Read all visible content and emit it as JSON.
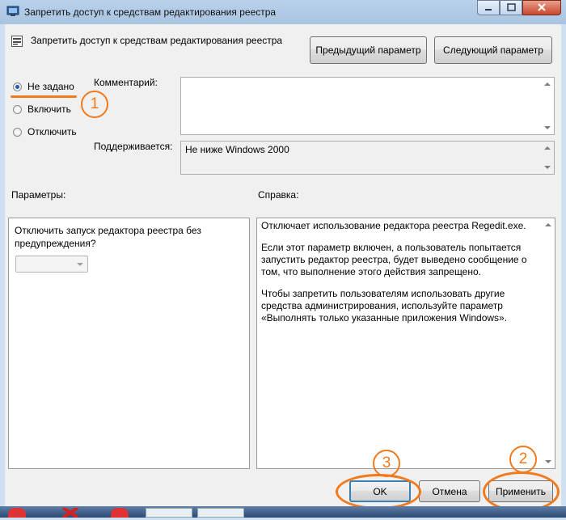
{
  "window": {
    "title": "Запретить доступ к средствам редактирования реестра"
  },
  "policy": {
    "title": "Запретить доступ к средствам редактирования реестра",
    "prev_label": "Предыдущий параметр",
    "next_label": "Следующий параметр"
  },
  "state": {
    "options": [
      {
        "label": "Не задано",
        "checked": true
      },
      {
        "label": "Включить",
        "checked": false
      },
      {
        "label": "Отключить",
        "checked": false
      }
    ]
  },
  "comment": {
    "label": "Комментарий:",
    "value": ""
  },
  "supported": {
    "label": "Поддерживается:",
    "value": "Не ниже Windows 2000"
  },
  "options_section": {
    "label": "Параметры:",
    "text": "Отключить запуск редактора реестра без предупреждения?",
    "combo_value": ""
  },
  "help_section": {
    "label": "Справка:",
    "paragraphs": [
      "Отключает использование редактора реестра Regedit.exe.",
      "Если этот параметр включен, а пользователь попытается запустить редактор реестра, будет выведено сообщение о том, что выполнение этого действия запрещено.",
      "Чтобы запретить пользователям использовать другие средства администрирования, используйте параметр «Выполнять только указанные приложения Windows»."
    ]
  },
  "footer": {
    "ok_label": "OK",
    "cancel_label": "Отмена",
    "apply_label": "Применить"
  },
  "annotations": {
    "step1": "1",
    "step2": "2",
    "step3": "3",
    "color": "#f07a1c"
  }
}
